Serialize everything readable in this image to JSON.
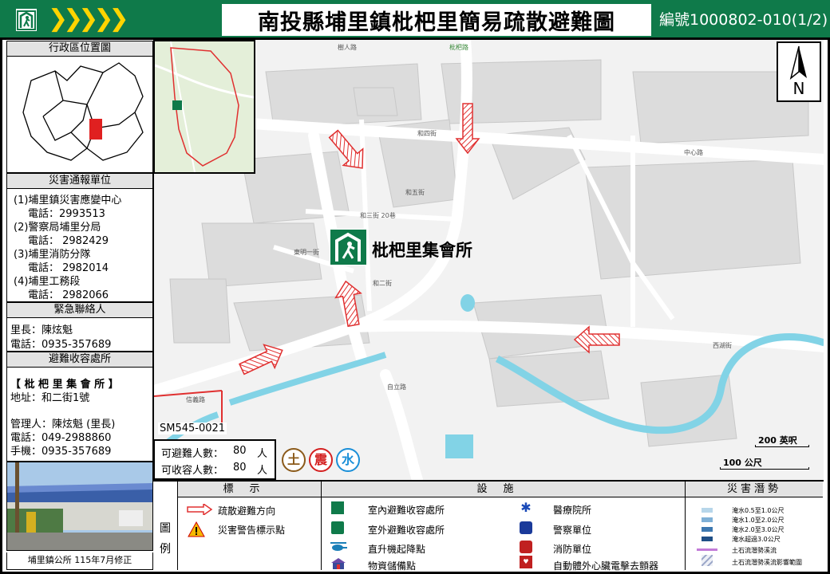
{
  "header": {
    "chevrons": "❯❯❯❯❯",
    "title": "南投縣埔里鎮枇杷里簡易疏散避難圖",
    "code": "編號1000802-010(1/2)"
  },
  "left_panel": {
    "location_title": "行政區位置圖",
    "contacts_title": "災害通報單位",
    "contacts": [
      {
        "name": "(1)埔里鎮災害應變中心",
        "phone": "電話：2993513"
      },
      {
        "name": "(2)警察局埔里分局",
        "phone": "電話： 2982429"
      },
      {
        "name": "(3)埔里消防分隊",
        "phone": "電話： 2982014"
      },
      {
        "name": "(4)埔里工務段",
        "phone": "電話： 2982066"
      }
    ],
    "emergency_title": "緊急聯絡人",
    "chief": "里長：陳炫魁",
    "chief_phone": "電話：0935-357689",
    "shelter_title": "避難收容處所",
    "shelter_name": "【 枇 杷 里 集 會 所 】",
    "shelter_address": "地址：和二街1號",
    "manager": "管理人：陳炫魁 (里長)",
    "manager_phone": "電話：049-2988860",
    "manager_mobile": "手機：0935-357689",
    "footer": "埔里鎮公所 115年7月修正"
  },
  "map": {
    "shelter_label": "枇杷里集會所",
    "sm_code": "SM545-0021",
    "north_label": "N",
    "scale_ft": "200 英呎",
    "scale_m": "100 公尺",
    "streets": [
      "樹人路",
      "和四街",
      "和五街",
      "枇杷路",
      "和三街 20巷",
      "東明一街",
      "中心路",
      "西湖街",
      "和二街",
      "自立路",
      "信義路"
    ],
    "capacity": [
      {
        "label": "可避難人數：",
        "value": "80",
        "unit": "人"
      },
      {
        "label": "可收容人數：",
        "value": "80",
        "unit": "人"
      }
    ],
    "hazard_badges": [
      {
        "label": "土",
        "color": "#8b5a1a"
      },
      {
        "label": "震",
        "color": "#d42020"
      },
      {
        "label": "水",
        "color": "#1a8fd8"
      }
    ]
  },
  "legend": {
    "side_label_top": "圖",
    "side_label_bottom": "例",
    "col1_title": "標示",
    "col2_title": "設施",
    "col3_title": "災害潛勢",
    "signs": [
      {
        "icon": "evacuation-arrow-icon",
        "label": "疏散避難方向"
      },
      {
        "icon": "warning-triangle-icon",
        "label": "災害警告標示點"
      }
    ],
    "facilities_left": [
      {
        "icon": "indoor-shelter-icon",
        "label": "室內避難收容處所"
      },
      {
        "icon": "outdoor-shelter-icon",
        "label": "室外避難收容處所"
      },
      {
        "icon": "helicopter-icon",
        "label": "直升機起降點"
      },
      {
        "icon": "supply-storage-icon",
        "label": "物資儲備點"
      }
    ],
    "facilities_right": [
      {
        "icon": "medical-icon",
        "label": "醫療院所"
      },
      {
        "icon": "police-icon",
        "label": "警察單位"
      },
      {
        "icon": "fire-station-icon",
        "label": "消防單位"
      },
      {
        "icon": "aed-icon",
        "label": "自動體外心臟電擊去顫器"
      }
    ],
    "hazards": [
      {
        "label": "淹水0.5至1.0公尺",
        "color": "#b7d6ea"
      },
      {
        "label": "淹水1.0至2.0公尺",
        "color": "#7fb0d6"
      },
      {
        "label": "淹水2.0至3.0公尺",
        "color": "#3d78b0"
      },
      {
        "label": "淹水超過3.0公尺",
        "color": "#1f4f86"
      },
      {
        "label": "土石流潛勢溪流",
        "color": "#c27bd8"
      },
      {
        "label": "土石流潛勢溪流影響範圍",
        "color": "#9aa6c8"
      }
    ]
  }
}
